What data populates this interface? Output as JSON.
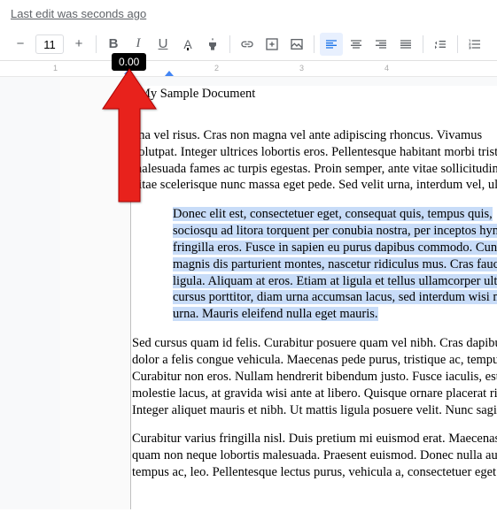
{
  "header": {
    "last_edit": "Last edit was seconds ago"
  },
  "toolbar": {
    "font_size": "11",
    "indent_value": "0.00"
  },
  "ruler": {
    "ticks": [
      "1",
      "2",
      "3",
      "4"
    ]
  },
  "document": {
    "title": "My Sample Document",
    "paragraphs": [
      {
        "indented": false,
        "selected": false,
        "lines": [
          "gna vel risus. Cras non magna vel ante adipiscing rhoncus. Vivamus",
          "volutpat. Integer ultrices lobortis eros. Pellentesque habitant morbi trist",
          "malesuada fames ac turpis egestas. Proin semper, ante vitae sollicitudin",
          "vitae scelerisque nunc massa eget pede. Sed velit urna, interdum vel, ul"
        ]
      },
      {
        "indented": true,
        "selected": true,
        "lines": [
          "Donec elit est, consectetuer eget, consequat quis, tempus quis,",
          "sociosqu ad litora torquent per conubia nostra, per inceptos hyn",
          "fringilla eros. Fusce in sapien eu purus dapibus commodo. Cun",
          "magnis dis parturient montes, nascetur ridiculus mus. Cras fauc",
          "ligula. Aliquam at eros. Etiam at ligula et tellus ullamcorper ultr",
          "cursus porttitor, diam urna accumsan lacus, sed interdum wisi n",
          "urna. Mauris eleifend nulla eget mauris."
        ]
      },
      {
        "indented": false,
        "selected": false,
        "lines": [
          "Sed cursus quam id felis. Curabitur posuere quam vel nibh. Cras dapibu",
          "dolor a felis congue vehicula. Maecenas pede purus, tristique ac, tempu",
          "Curabitur non eros. Nullam hendrerit bibendum justo. Fusce iaculis, est",
          "molestie lacus, at gravida wisi ante at libero. Quisque ornare placerat ri",
          "Integer aliquet mauris et nibh. Ut mattis ligula posuere velit. Nunc sagi"
        ]
      },
      {
        "indented": false,
        "selected": false,
        "lines": [
          "Curabitur varius fringilla nisl. Duis pretium mi euismod erat. Maecenas",
          "quam non neque lobortis malesuada. Praesent euismod. Donec nulla au",
          "tempus ac, leo. Pellentesque lectus purus, vehicula a, consectetuer eget"
        ]
      }
    ]
  }
}
